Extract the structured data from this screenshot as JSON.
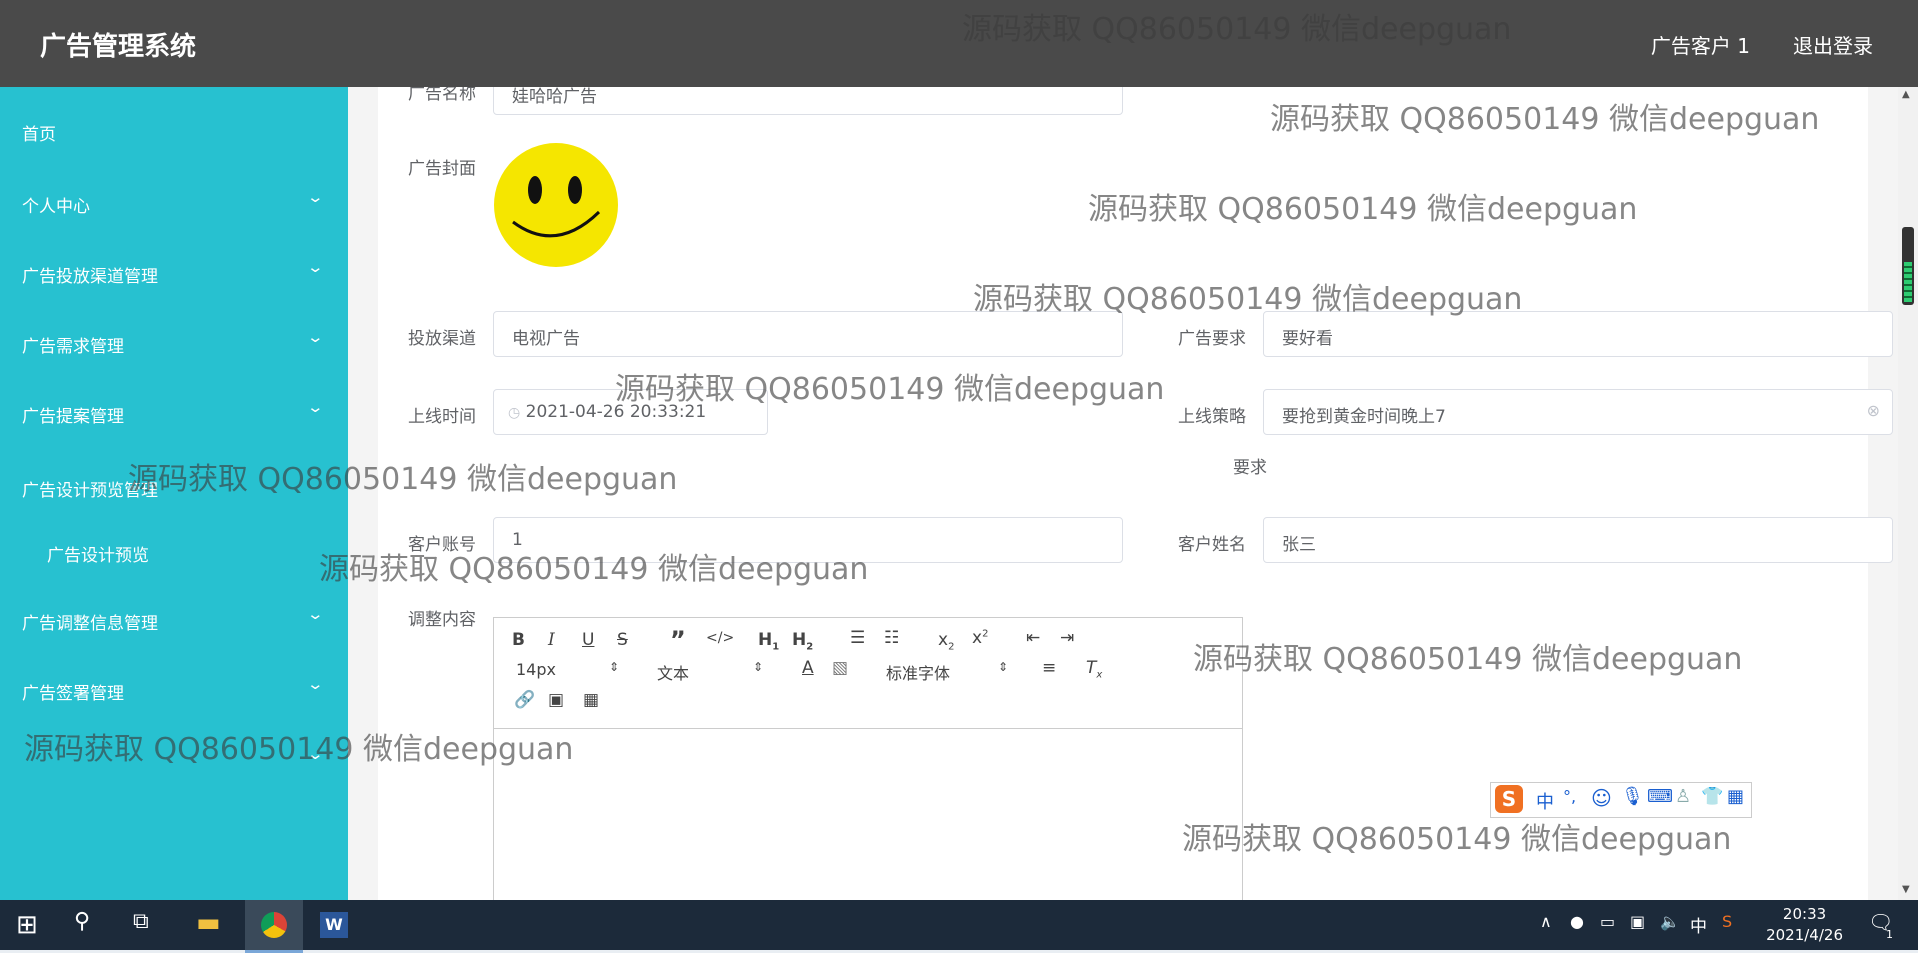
{
  "header": {
    "title": "广告管理系统",
    "user": "广告客户 1",
    "logout": "退出登录"
  },
  "sidebar": {
    "items": [
      {
        "label": "首页",
        "chevron": false
      },
      {
        "label": "个人中心",
        "chevron": true
      },
      {
        "label": "广告投放渠道管理",
        "chevron": true
      },
      {
        "label": "广告需求管理",
        "chevron": true
      },
      {
        "label": "广告提案管理",
        "chevron": true
      },
      {
        "label": "广告设计预览管理",
        "chevron": false
      },
      {
        "label": "广告设计预览",
        "chevron": false,
        "sub": true
      },
      {
        "label": "广告调整信息管理",
        "chevron": true
      },
      {
        "label": "广告签署管理",
        "chevron": true
      },
      {
        "label": "",
        "chevron": true
      }
    ]
  },
  "form": {
    "name_label": "广告名称",
    "name_value": "娃哈哈广告",
    "cover_label": "广告封面",
    "channel_label": "投放渠道",
    "channel_value": "电视广告",
    "require_label": "广告要求",
    "require_value": "要好看",
    "time_label": "上线时间",
    "time_value": "2021-04-26 20:33:21",
    "strategy_label": "上线策略",
    "strategy_value": "要抢到黄金时间晚上7",
    "request_label": "要求",
    "account_label": "客户账号",
    "account_value": "1",
    "customer_label": "客户姓名",
    "customer_value": "张三",
    "adjust_label": "调整内容"
  },
  "editor": {
    "font_size": "14px",
    "paragraph": "文本",
    "font_family": "标准字体"
  },
  "watermark": "源码获取 QQ86050149 微信deepguan",
  "taskbar": {
    "time": "20:33",
    "date": "2021/4/26",
    "ime_lang": "中",
    "notify_count": "1"
  },
  "ime_bar": {
    "lang": "中",
    "punct": "°,"
  }
}
